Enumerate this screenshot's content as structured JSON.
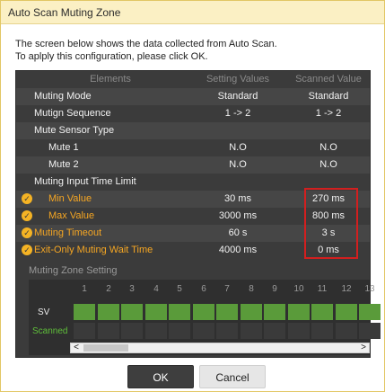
{
  "window": {
    "title": "Auto Scan Muting Zone"
  },
  "description": [
    "The screen below shows the data collected from Auto Scan.",
    "To aplply this configuration, please click OK."
  ],
  "table": {
    "headers": {
      "elements": "Elements",
      "setting": "Setting Values",
      "scanned": "Scanned Value"
    },
    "rows": [
      {
        "element": "Muting Mode",
        "setting": "Standard",
        "scanned": "Standard"
      },
      {
        "element": "Mutign Sequence",
        "setting": "1 -> 2",
        "scanned": "1 -> 2"
      },
      {
        "element": "Mute Sensor Type",
        "setting": "",
        "scanned": ""
      },
      {
        "element": "Mute 1",
        "setting": "N.O",
        "scanned": "N.O"
      },
      {
        "element": "Mute 2",
        "setting": "N.O",
        "scanned": "N.O"
      },
      {
        "element": "Muting Input Time Limit",
        "setting": "",
        "scanned": ""
      },
      {
        "element": "Min Value",
        "setting": "30 ms",
        "scanned": "270 ms"
      },
      {
        "element": "Max Value",
        "setting": "3000 ms",
        "scanned": "800 ms"
      },
      {
        "element": "Muting Timeout",
        "setting": "60 s",
        "scanned": "3 s"
      },
      {
        "element": "Exit-Only Muting Wait Time",
        "setting": "4000 ms",
        "scanned": "0 ms"
      }
    ]
  },
  "muting_zone": {
    "title": "Muting Zone Setting",
    "columns": [
      "1",
      "2",
      "3",
      "4",
      "5",
      "6",
      "7",
      "8",
      "9",
      "10",
      "11",
      "12",
      "13"
    ],
    "sv_label": "SV",
    "scanned_label": "Scanned",
    "scrollbar": {
      "left_arrow": "<",
      "right_arrow": ">"
    }
  },
  "buttons": {
    "ok": "OK",
    "cancel": "Cancel"
  },
  "colors": {
    "accent": "#f5a623",
    "highlight": "#d21f1f",
    "sv_cell": "#5a9b3a",
    "check": "#f5b324"
  },
  "icons": {
    "check": "check-icon"
  }
}
